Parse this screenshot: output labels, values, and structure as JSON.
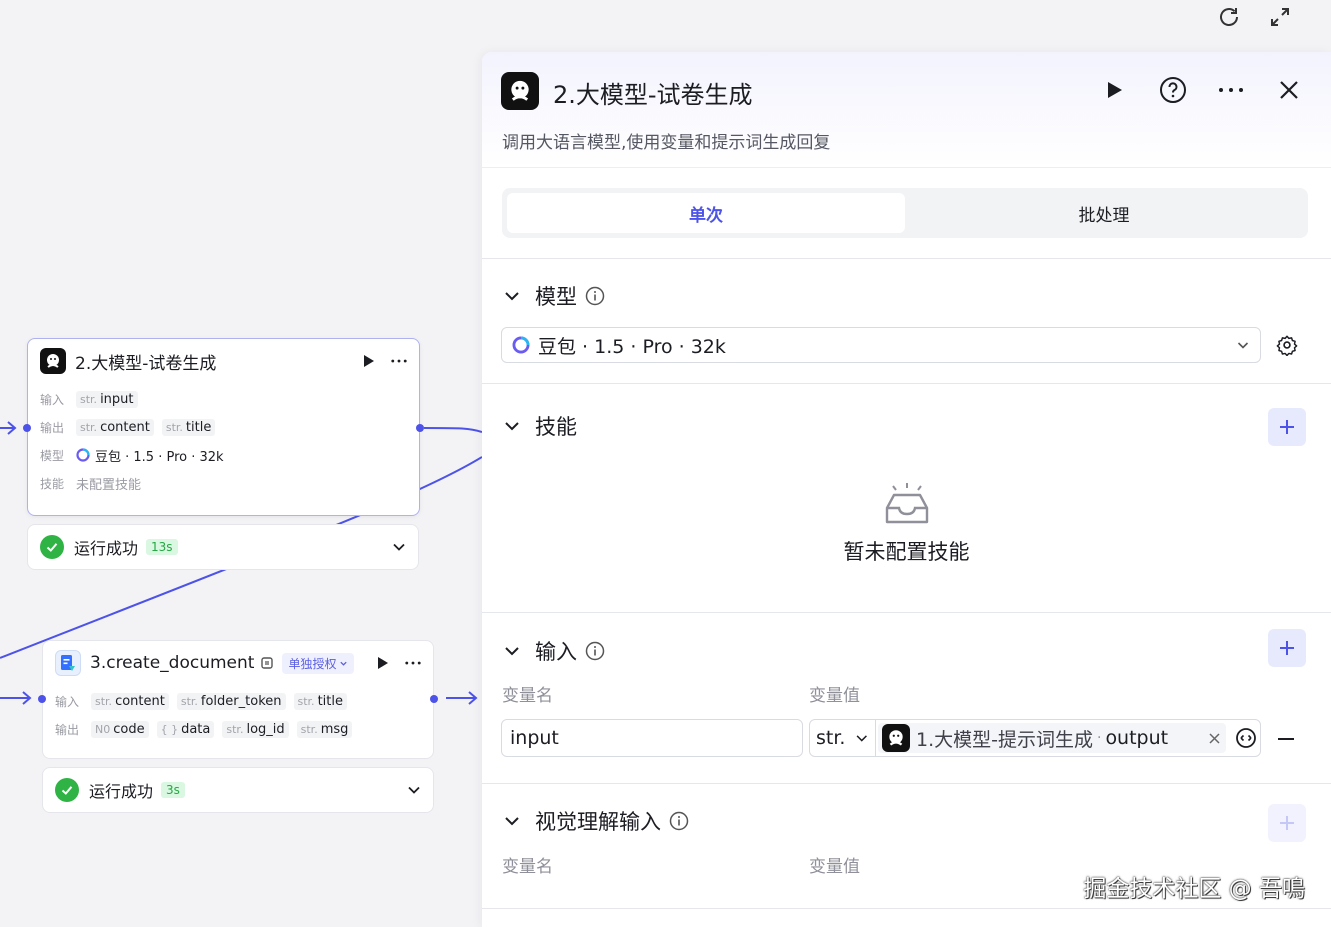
{
  "canvas": {
    "nodes": [
      {
        "title": "2.大模型-试卷生成",
        "inputs_label": "输入",
        "inputs": [
          {
            "type": "str.",
            "name": "input"
          }
        ],
        "outputs_label": "输出",
        "outputs": [
          {
            "type": "str.",
            "name": "content"
          },
          {
            "type": "str.",
            "name": "title"
          }
        ],
        "model_label": "模型",
        "model": "豆包 · 1.5 · Pro · 32k",
        "skills_label": "技能",
        "skills": "未配置技能",
        "status": {
          "text": "运行成功",
          "time": "13s"
        }
      },
      {
        "title": "3.create_document",
        "auth_badge": "单独授权",
        "inputs_label": "输入",
        "inputs": [
          {
            "type": "str.",
            "name": "content"
          },
          {
            "type": "str.",
            "name": "folder_token"
          },
          {
            "type": "str.",
            "name": "title"
          }
        ],
        "outputs_label": "输出",
        "outputs": [
          {
            "type": "N0",
            "name": "code"
          },
          {
            "type": "{ }",
            "name": "data"
          },
          {
            "type": "str.",
            "name": "log_id"
          },
          {
            "type": "str.",
            "name": "msg"
          }
        ],
        "status": {
          "text": "运行成功",
          "time": "3s"
        }
      }
    ]
  },
  "panel": {
    "title": "2.大模型-试卷生成",
    "description": "调用大语言模型,使用变量和提示词生成回复",
    "tabs": [
      {
        "label": "单次",
        "active": true
      },
      {
        "label": "批处理",
        "active": false
      }
    ],
    "sections": {
      "model": {
        "title": "模型",
        "value": "豆包 · 1.5 · Pro · 32k"
      },
      "skills": {
        "title": "技能",
        "empty_text": "暂未配置技能"
      },
      "input": {
        "title": "输入",
        "col_name": "变量名",
        "col_value": "变量值",
        "rows": [
          {
            "name": "input",
            "type": "str.",
            "ref_node": "1.大模型-提示词生成",
            "ref_var": "output"
          }
        ]
      },
      "vision": {
        "title": "视觉理解输入",
        "col_name": "变量名",
        "col_value": "变量值"
      }
    }
  },
  "watermark": "掘金技术社区 @ 吾鳴",
  "colors": {
    "accent": "#4d53e8",
    "success": "#2fb344",
    "edge": "#4d53e8"
  }
}
